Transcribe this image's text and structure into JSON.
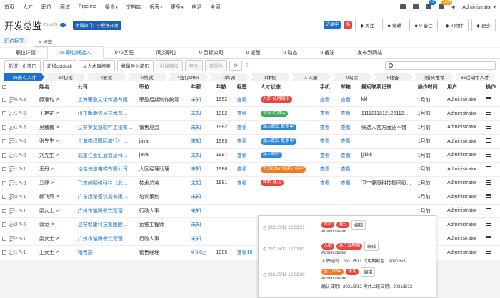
{
  "nav": {
    "items": [
      "首页",
      "人才",
      "职位",
      "面试",
      "Pipeline",
      "渠道",
      "文档库",
      "报表",
      "更多",
      "电话",
      "全网"
    ],
    "dropdown_items": [
      "渠道",
      "报表",
      "更多"
    ],
    "mail_badge": "17",
    "bell_badge": "1970",
    "user": "Administrator"
  },
  "header": {
    "title": "开发总监",
    "id": "ID:465",
    "dept": "所属部门：小程序开发",
    "status_tags": [
      {
        "text": "进展中",
        "color": "#1a73c8"
      },
      {
        "text": "高",
        "color": "#e8453c"
      }
    ],
    "buttons": [
      "关注",
      "编辑",
      "0 备注",
      "0 附件",
      "更多"
    ]
  },
  "labels": {
    "label": "职位标签：",
    "button": "标签"
  },
  "tabs": [
    "职位详情",
    "36 职位候选人",
    "0 AI匹配",
    "同类职位",
    "0 目标公司",
    "0 提醒",
    "0 动态",
    "0 备注",
    "发布到网站"
  ],
  "active_tab": 1,
  "toolbar": {
    "buttons": [
      "新增一份简历",
      "新增coldcall",
      "从人才库搜索",
      "批量导入简历",
      "批量操作",
      "更多",
      "背景色"
    ],
    "disabled": [
      4,
      5,
      6
    ],
    "search_placeholder": ""
  },
  "pipeline": [
    "36所有人才",
    "30初试",
    "0复试",
    "0终试",
    "4签订Offer",
    "0背调",
    "1体检",
    "1 入职",
    "0淘汰",
    "0储备",
    "0猎头推荐",
    "36活动中人才"
  ],
  "columns": [
    "",
    "姓名",
    "公司",
    "职位",
    "年薪",
    "年龄",
    "标签",
    "人才状态",
    "手机",
    "邮箱",
    "最近联系记录",
    "操作时间",
    "用户",
    "操作"
  ],
  "rows": [
    {
      "meta": "5 4",
      "name": "薛逸均",
      "company": "上海荣盈文化传播有限…",
      "position": "荣盈后期制作统筹",
      "salary": "未知",
      "age": "1992",
      "tag": "查看",
      "status": [
        {
          "t": "入职 试用期中",
          "c": "red"
        }
      ],
      "phone": "查看",
      "email": "查看",
      "contact": "kkl",
      "time": "1月前",
      "user": "Administrator"
    },
    {
      "meta": "1 5",
      "name": "王艳花",
      "company": "山东新潮信息技术有…",
      "position": "",
      "salary": "未知",
      "age": "1982",
      "tag": "查看",
      "status": [
        {
          "t": "初试 待测试",
          "c": "green"
        }
      ],
      "phone": "查看",
      "email": "查看",
      "contact": "1111211212122112...",
      "time": "1月前",
      "user": "Administrator"
    },
    {
      "meta": "1 4",
      "name": "吴巍巍",
      "company": "辽宁罗斐迪软件工程有…",
      "position": "销售总监",
      "salary": "未知",
      "age": "1982",
      "tag": "查看",
      "status": [
        {
          "t": "加入职位 联系中",
          "c": "blue"
        }
      ],
      "phone": "查看",
      "email": "查看",
      "contact": "候选人各方面还不错",
      "time": "1月前",
      "user": "Administrator"
    },
    {
      "meta": "1 0",
      "name": "张先生",
      "company": "上海携程国际旅行社…",
      "position": "java",
      "salary": "未知",
      "age": "1985",
      "tag": "查看",
      "status": [
        {
          "t": "加入职位 联系中",
          "c": "blue"
        }
      ],
      "phone": "查看",
      "email": "查看",
      "contact": "",
      "time": "1月前",
      "user": "Administrator"
    },
    {
      "meta": "1 0",
      "name": "刘先生",
      "company": "北京仁爱汇通信息科…",
      "position": "java",
      "salary": "未知",
      "age": "1997",
      "tag": "查看",
      "status": [
        {
          "t": "加入职位",
          "c": "blue"
        }
      ],
      "phone": "查看",
      "email": "查看",
      "contact": "jjjkkk",
      "time": "1月前",
      "user": "Administrator"
    },
    {
      "meta": "1 1",
      "name": "王丹",
      "company": "怡达快速电梯有限公司",
      "position": "大区经理助理",
      "salary": "未知",
      "age": "1988",
      "tag": "查看",
      "status": [
        {
          "t": "签订Offer 需求分析中",
          "c": "orange"
        }
      ],
      "phone": "查看",
      "email": "查看",
      "contact": "",
      "time": "1月前",
      "user": "Administrator"
    },
    {
      "meta": "1 3",
      "name": "马健",
      "company": "飞普越网络科技（北…",
      "position": "技术总监",
      "salary": "未知",
      "age": "1981",
      "tag": "查看",
      "status": [
        {
          "t": "体检 通过",
          "c": "red"
        }
      ],
      "phone": "查看",
      "email": "查看",
      "contact": "卫宁健康科技集团股…",
      "time": "1月前",
      "user": "Administrator"
    },
    {
      "meta": "2 1",
      "name": "赖飞燕",
      "company": "广东超秘密谍具有限…",
      "position": "培训策划",
      "salary": "未知",
      "age": "",
      "tag": "",
      "status": [],
      "phone": "",
      "email": "",
      "contact": "",
      "time": "1月前",
      "user": "Administrator"
    },
    {
      "meta": "1 1",
      "name": "梁女士",
      "company": "广州市骏腾餐饮管理…",
      "position": "行政人事",
      "salary": "未知",
      "age": "",
      "tag": "",
      "status": [],
      "phone": "",
      "email": "",
      "contact": "",
      "time": "1月前",
      "user": "Administrator"
    },
    {
      "meta": "2 6",
      "name": "郭龙",
      "company": "卫宁健康科技集团股…",
      "position": "运维工程师",
      "salary": "未知",
      "age": "",
      "tag": "",
      "status": [],
      "phone": "",
      "email": "",
      "contact": "",
      "time": "1月前",
      "user": "Administrator"
    },
    {
      "meta": "2 1",
      "name": "梁女士",
      "company": "广州市骏腾餐饮管理…",
      "position": "行政人事",
      "salary": "未知",
      "age": "",
      "tag": "",
      "status": [],
      "phone": "",
      "email": "",
      "contact": "",
      "time": "1月前",
      "user": "Administrator"
    },
    {
      "meta": "1 1",
      "name": "王女士",
      "company": "销售部",
      "position": "销售经理",
      "salary": "¥ 3.0万",
      "age": "1985",
      "tag": "查看10",
      "status": [],
      "phone": "",
      "email": "",
      "contact": "",
      "time": "1月前",
      "user": "Administrator"
    }
  ],
  "popup": [
    {
      "time": "2021/5/12 12:03:27",
      "tags": [
        {
          "t": "体检",
          "c": "#e8453c"
        },
        {
          "t": "通过",
          "c": "#e8453c"
        }
      ],
      "edit": "编辑",
      "user": "Administrator",
      "lines": []
    },
    {
      "time": "2021/5/12 12:03:01",
      "tags": [
        {
          "t": "入职",
          "c": "#e8453c"
        },
        {
          "t": "通过试用期",
          "c": "#e8453c"
        }
      ],
      "edit": "编辑",
      "user": "Administrator",
      "lines": [
        "入职时间：2021/5/12  试用期截至：2021/6/3"
      ]
    },
    {
      "time": "2021/5/12 12:02:36",
      "tags": [
        {
          "t": "签订Offer",
          "c": "#f07a22"
        },
        {
          "t": "录用",
          "c": "#e8453c"
        }
      ],
      "edit": "编辑",
      "user": "Administrator",
      "lines": [
        "确认日期：2021/5/12  预计上班日期：2021/5/12"
      ]
    }
  ]
}
